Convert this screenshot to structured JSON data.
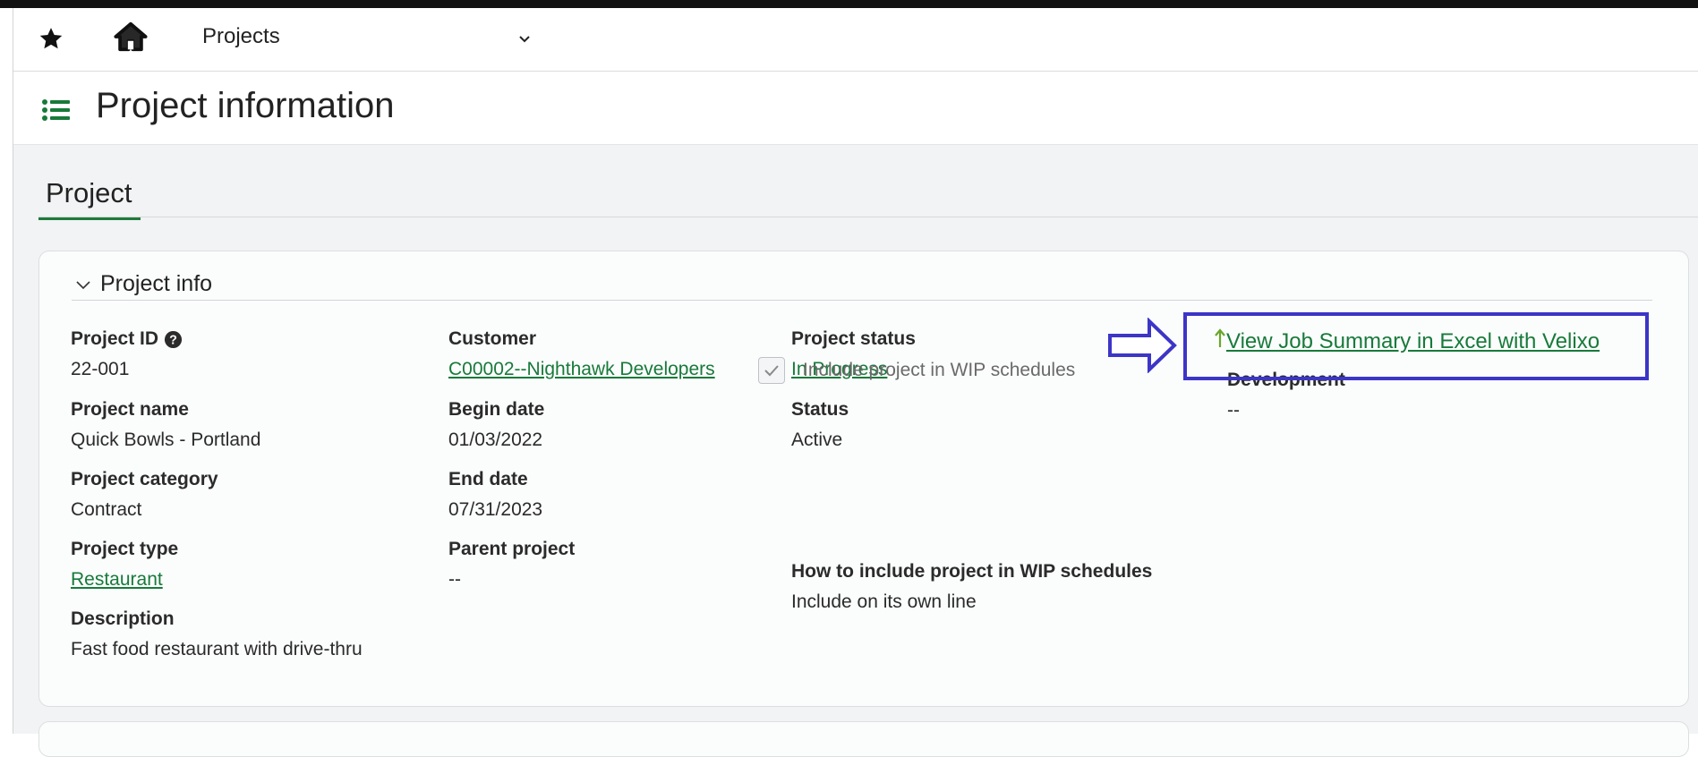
{
  "nav": {
    "module": "Projects",
    "star_icon": "star-icon",
    "home_icon": "home-icon",
    "dropdown_icon": "chevron-down-icon"
  },
  "header": {
    "title": "Project information",
    "menu_icon": "list-icon"
  },
  "tabs": [
    {
      "label": "Project",
      "active": true
    }
  ],
  "section": {
    "title": "Project info",
    "collapse_icon": "chevron-down-icon"
  },
  "fields": {
    "project_id": {
      "label": "Project ID",
      "value": "22-001"
    },
    "project_name": {
      "label": "Project name",
      "value": "Quick Bowls - Portland"
    },
    "project_category": {
      "label": "Project category",
      "value": "Contract"
    },
    "project_type": {
      "label": "Project type",
      "value": "Restaurant"
    },
    "description": {
      "label": "Description",
      "value": "Fast food restaurant with drive-thru"
    },
    "customer": {
      "label": "Customer",
      "value": "C00002--Nighthawk Developers"
    },
    "begin_date": {
      "label": "Begin date",
      "value": "01/03/2022"
    },
    "end_date": {
      "label": "End date",
      "value": "07/31/2023"
    },
    "parent_project": {
      "label": "Parent project",
      "value": "--"
    },
    "project_status": {
      "label": "Project status",
      "value": "In Progress"
    },
    "status": {
      "label": "Status",
      "value": "Active"
    },
    "wip_include": {
      "label": "Include project in WIP schedules",
      "checked": true
    },
    "wip_how": {
      "label": "How to include project in WIP schedules",
      "value": "Include on its own line"
    },
    "development": {
      "label": "Development",
      "value": "--"
    }
  },
  "velixo": {
    "link": "View Job Summary in Excel with Velixo",
    "arrow_icon": "up-arrow-icon",
    "annotation_color": "#3c35c6"
  },
  "colors": {
    "accent": "#177a3a",
    "annotation": "#3c35c6"
  }
}
